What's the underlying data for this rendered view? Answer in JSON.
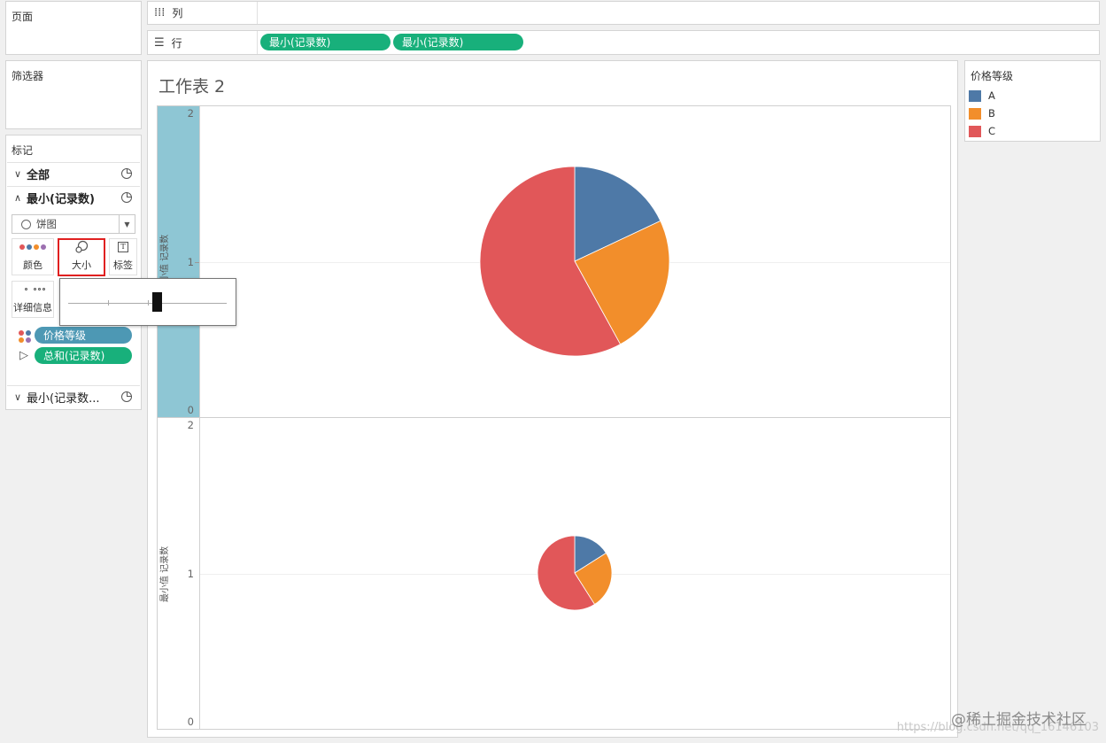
{
  "panels": {
    "pages_title": "页面",
    "filters_title": "筛选器",
    "marks_title": "标记"
  },
  "marks": {
    "all_label": "全部",
    "active_card_label": "最小(记录数)",
    "collapsed_card_label": "最小(记录数...",
    "mark_type": "饼图",
    "buttons": {
      "color": "颜色",
      "size": "大小",
      "label": "标签",
      "detail": "详细信息"
    },
    "pills": {
      "color_field": "价格等级",
      "size_field": "总和(记录数)"
    }
  },
  "size_slider": {
    "value_fraction": 0.56
  },
  "shelves": {
    "columns_label": "列",
    "rows_label": "行",
    "row_pills": [
      "最小(记录数)",
      "最小(记录数)"
    ]
  },
  "sheet": {
    "title": "工作表 2",
    "axis_title": "最小值 记录数",
    "ticks": [
      "2",
      "1",
      "0"
    ]
  },
  "legend": {
    "title": "价格等级",
    "items": [
      {
        "label": "A",
        "color": "#4e79a7"
      },
      {
        "label": "B",
        "color": "#f28e2b"
      },
      {
        "label": "C",
        "color": "#e15759"
      }
    ]
  },
  "chart_data": [
    {
      "type": "pie",
      "labels": [
        "A",
        "B",
        "C"
      ],
      "values": [
        18,
        24,
        58
      ],
      "colors": [
        "#4e79a7",
        "#f28e2b",
        "#e15759"
      ],
      "ylim": [
        0,
        2
      ],
      "y": 1,
      "size": "large"
    },
    {
      "type": "pie",
      "labels": [
        "A",
        "B",
        "C"
      ],
      "values": [
        16,
        25,
        59
      ],
      "colors": [
        "#4e79a7",
        "#f28e2b",
        "#e15759"
      ],
      "ylim": [
        0,
        2
      ],
      "y": 1,
      "size": "small"
    }
  ],
  "watermark": {
    "text": "@稀土掘金技术社区",
    "url": "https://blog.csdn.net/qq_16146103"
  }
}
